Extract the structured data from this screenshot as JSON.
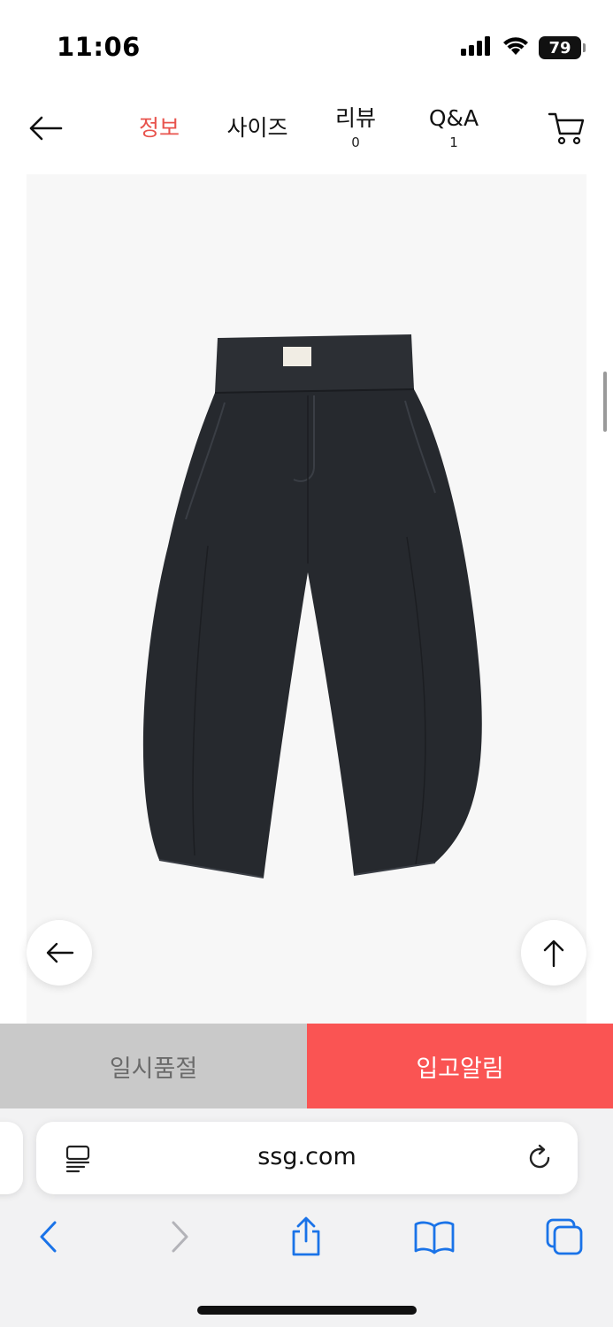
{
  "status_bar": {
    "time": "11:06",
    "battery": "79",
    "icons": [
      "signal-icon",
      "wifi-icon",
      "battery-icon"
    ]
  },
  "header": {
    "back_icon": "arrow-left-icon",
    "tabs": [
      {
        "label": "정보",
        "count": "",
        "active": true
      },
      {
        "label": "사이즈",
        "count": "",
        "active": false
      },
      {
        "label": "리뷰",
        "count": "0",
        "active": false
      },
      {
        "label": "Q&A",
        "count": "1",
        "active": false
      }
    ],
    "cart_icon": "cart-icon"
  },
  "product": {
    "image_icon": "trousers-image",
    "prev_icon": "arrow-left-icon",
    "top_icon": "arrow-up-icon"
  },
  "actions": {
    "soldout_label": "일시품절",
    "notify_label": "입고알림"
  },
  "browser": {
    "url": "ssg.com",
    "toolbar_icons": [
      "back-icon",
      "forward-icon",
      "share-icon",
      "bookmarks-icon",
      "tabs-icon"
    ]
  },
  "colors": {
    "accent": "#fa5453",
    "active_tab": "#e8534d",
    "soldout_bg": "#c9c9c9",
    "ios_blue": "#1a73e8"
  }
}
